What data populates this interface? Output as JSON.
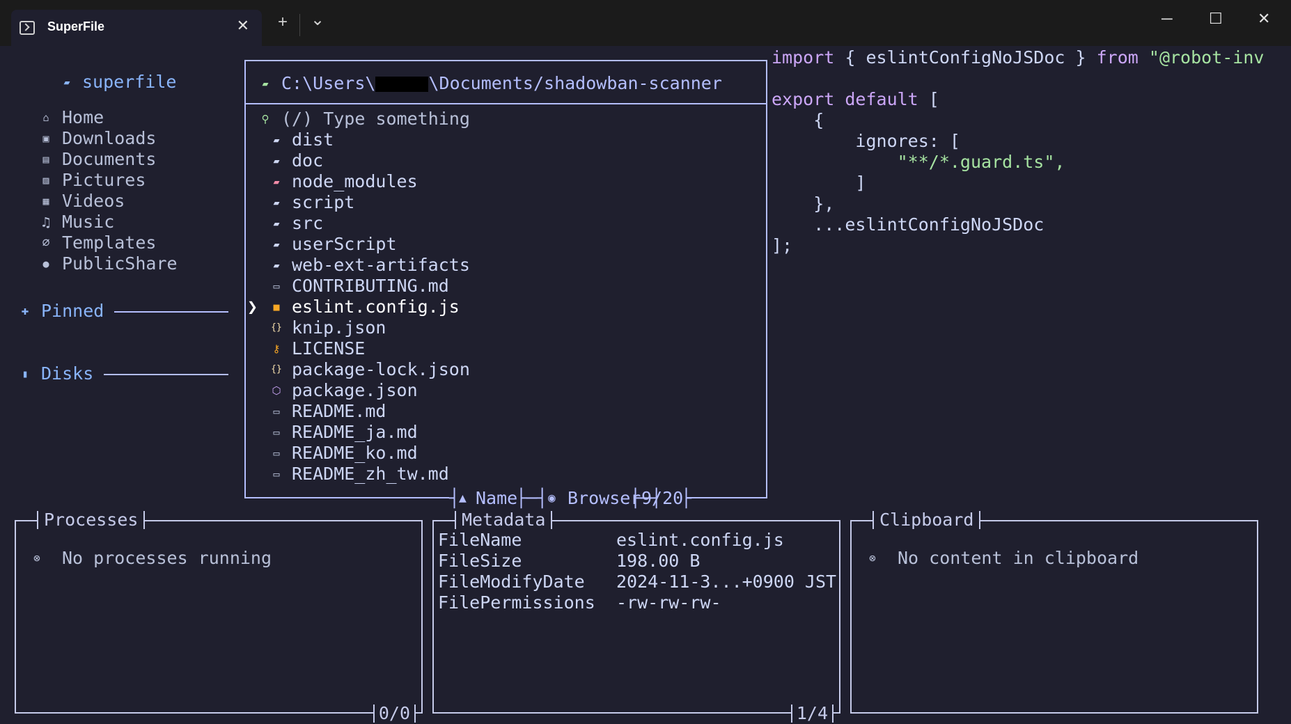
{
  "window": {
    "tab_title": "SuperFile",
    "tab_close": "✕",
    "new_tab": "+",
    "dropdown": "⌄",
    "minimize": "─",
    "maximize": "☐",
    "close": "✕"
  },
  "sidebar": {
    "app_name": "superfile",
    "items": [
      {
        "label": "Home",
        "icon": "home-icon"
      },
      {
        "label": "Downloads",
        "icon": "download-icon"
      },
      {
        "label": "Documents",
        "icon": "document-icon"
      },
      {
        "label": "Pictures",
        "icon": "picture-icon"
      },
      {
        "label": "Videos",
        "icon": "video-icon"
      },
      {
        "label": "Music",
        "icon": "music-icon"
      },
      {
        "label": "Templates",
        "icon": "paperclip-icon"
      },
      {
        "label": "PublicShare",
        "icon": "globe-icon"
      }
    ],
    "pinned_label": "Pinned",
    "disks_label": "Disks"
  },
  "file_panel": {
    "path_prefix": "C:\\Users\\",
    "path_suffix": "\\Documents/shadowban-scanner",
    "search_placeholder": "(/) Type something",
    "files": [
      {
        "name": "dist",
        "icon": "folder-icon"
      },
      {
        "name": "doc",
        "icon": "folder-icon"
      },
      {
        "name": "node_modules",
        "icon": "npm-folder-icon"
      },
      {
        "name": "script",
        "icon": "folder-icon"
      },
      {
        "name": "src",
        "icon": "folder-icon"
      },
      {
        "name": "userScript",
        "icon": "folder-icon"
      },
      {
        "name": "web-ext-artifacts",
        "icon": "folder-icon"
      },
      {
        "name": "CONTRIBUTING.md",
        "icon": "markdown-icon"
      },
      {
        "name": "eslint.config.js",
        "icon": "js-icon"
      },
      {
        "name": "knip.json",
        "icon": "json-icon"
      },
      {
        "name": "LICENSE",
        "icon": "key-icon"
      },
      {
        "name": "package-lock.json",
        "icon": "json-icon"
      },
      {
        "name": "package.json",
        "icon": "package-icon"
      },
      {
        "name": "README.md",
        "icon": "markdown-icon"
      },
      {
        "name": "README_ja.md",
        "icon": "markdown-icon"
      },
      {
        "name": "README_ko.md",
        "icon": "markdown-icon"
      },
      {
        "name": "README_zh_tw.md",
        "icon": "markdown-icon"
      }
    ],
    "selected": "eslint.config.js",
    "sort_label": "Name",
    "mode_label": "Browser",
    "count": "9/20"
  },
  "preview": {
    "lines": [
      [
        "import",
        " { eslintConfigNoJSDoc } ",
        "from",
        " ",
        "\"@robot-inv"
      ],
      [
        "",
        "",
        "",
        "",
        ""
      ],
      [
        "export default",
        " [",
        "",
        "",
        ""
      ],
      [
        "",
        "    {",
        "",
        "",
        ""
      ],
      [
        "",
        "        ignores: [",
        "",
        "",
        ""
      ],
      [
        "",
        "            ",
        "",
        "",
        "\"**/*.guard.ts\","
      ],
      [
        "",
        "        ]",
        "",
        "",
        ""
      ],
      [
        "",
        "    },",
        "",
        "",
        ""
      ],
      [
        "",
        "    ...eslintConfigNoJSDoc",
        "",
        "",
        ""
      ],
      [
        "",
        "];",
        "",
        "",
        ""
      ]
    ]
  },
  "processes": {
    "title": "Processes",
    "message": "No processes running",
    "count": "0/0"
  },
  "metadata": {
    "title": "Metadata",
    "rows": [
      {
        "key": "FileName",
        "value": "eslint.config.js"
      },
      {
        "key": "FileSize",
        "value": "198.00 B"
      },
      {
        "key": "FileModifyDate",
        "value": "2024-11-3...+0900 JST"
      },
      {
        "key": "FilePermissions",
        "value": "-rw-rw-rw-"
      }
    ],
    "count": "1/4"
  },
  "clipboard": {
    "title": "Clipboard",
    "message": "No content in clipboard"
  },
  "colors": {
    "accent": "#89b4fa",
    "border": "#b4befe",
    "background": "#1f1f2e",
    "keyword": "#cba6f7",
    "string": "#a6e3a1"
  }
}
